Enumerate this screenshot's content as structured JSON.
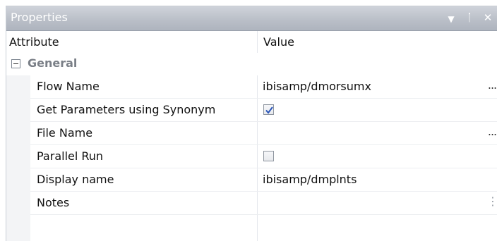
{
  "panel": {
    "title": "Properties",
    "dropdown_icon": "▼",
    "pin_icon": "ᛙ",
    "close_icon": "✕"
  },
  "columns": {
    "attribute": "Attribute",
    "value": "Value"
  },
  "category": {
    "label": "General",
    "expanded": true
  },
  "rows": [
    {
      "name": "Flow Name",
      "value": "ibisamp/dmorsumx",
      "ellipsis": "..."
    },
    {
      "name": "Get Parameters using Synonym",
      "checked": true
    },
    {
      "name": "File Name",
      "value": "",
      "ellipsis": "..."
    },
    {
      "name": "Parallel Run",
      "checked": false
    },
    {
      "name": "Display name",
      "value": "ibisamp/dmplnts"
    },
    {
      "name": "Notes",
      "value": "",
      "ellipsis": "⋮"
    }
  ]
}
